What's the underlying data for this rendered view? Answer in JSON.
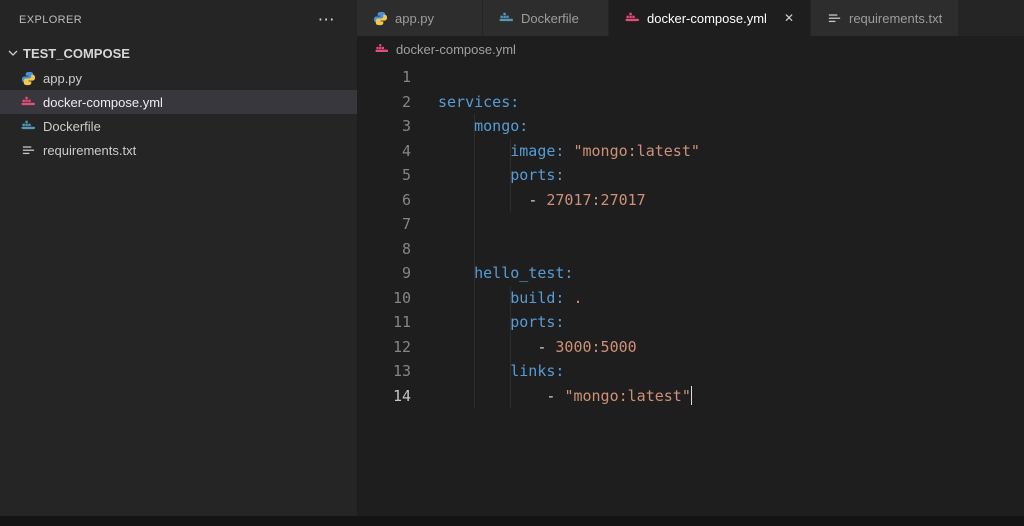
{
  "colors": {
    "python_blue": "#4a90d9",
    "python_yellow": "#f2c94c",
    "docker_blue": "#519aba",
    "compose_pink": "#e64d79",
    "text_gray": "#c5c5c5",
    "key_color": "#569cd6",
    "string_color": "#ce9178",
    "plain_color": "#d4d4d4"
  },
  "explorer": {
    "title": "EXPLORER",
    "more_actions": "⋯",
    "folder": {
      "label": "TEST_COMPOSE"
    },
    "files": [
      {
        "label": "app.py",
        "icon": "python-icon",
        "selected": false
      },
      {
        "label": "docker-compose.yml",
        "icon": "docker-compose-icon",
        "selected": true
      },
      {
        "label": "Dockerfile",
        "icon": "docker-icon",
        "selected": false
      },
      {
        "label": "requirements.txt",
        "icon": "text-file-icon",
        "selected": false
      }
    ]
  },
  "tabs": [
    {
      "label": "app.py",
      "icon": "python-icon",
      "active": false
    },
    {
      "label": "Dockerfile",
      "icon": "docker-icon",
      "active": false
    },
    {
      "label": "docker-compose.yml",
      "icon": "docker-compose-icon",
      "active": true,
      "close_label": "✕"
    },
    {
      "label": "requirements.txt",
      "icon": "text-file-icon",
      "active": false
    }
  ],
  "breadcrumb": {
    "label": "docker-compose.yml",
    "icon": "docker-compose-icon"
  },
  "editor": {
    "language": "yaml",
    "cursor_line": 14,
    "lines": [
      {
        "n": 1,
        "tokens": []
      },
      {
        "n": 2,
        "tokens": [
          [
            "services:",
            "key"
          ]
        ]
      },
      {
        "n": 3,
        "tokens": [
          [
            "    ",
            "pun"
          ],
          [
            "mongo:",
            "key"
          ]
        ]
      },
      {
        "n": 4,
        "tokens": [
          [
            "        ",
            "pun"
          ],
          [
            "image:",
            "key"
          ],
          [
            " ",
            "pun"
          ],
          [
            "\"mongo:latest\"",
            "str"
          ]
        ]
      },
      {
        "n": 5,
        "tokens": [
          [
            "        ",
            "pun"
          ],
          [
            "ports:",
            "key"
          ]
        ]
      },
      {
        "n": 6,
        "tokens": [
          [
            "          ",
            "pun"
          ],
          [
            "- ",
            "pun"
          ],
          [
            "27017:27017",
            "str"
          ]
        ]
      },
      {
        "n": 7,
        "tokens": []
      },
      {
        "n": 8,
        "tokens": []
      },
      {
        "n": 9,
        "tokens": [
          [
            "    ",
            "pun"
          ],
          [
            "hello_test:",
            "key"
          ]
        ]
      },
      {
        "n": 10,
        "tokens": [
          [
            "        ",
            "pun"
          ],
          [
            "build:",
            "key"
          ],
          [
            " ",
            "pun"
          ],
          [
            ".",
            "str"
          ]
        ]
      },
      {
        "n": 11,
        "tokens": [
          [
            "        ",
            "pun"
          ],
          [
            "ports:",
            "key"
          ]
        ]
      },
      {
        "n": 12,
        "tokens": [
          [
            "           ",
            "pun"
          ],
          [
            "- ",
            "pun"
          ],
          [
            "3000:5000",
            "str"
          ]
        ]
      },
      {
        "n": 13,
        "tokens": [
          [
            "        ",
            "pun"
          ],
          [
            "links:",
            "key"
          ]
        ]
      },
      {
        "n": 14,
        "tokens": [
          [
            "            ",
            "pun"
          ],
          [
            "- ",
            "pun"
          ],
          [
            "\"mongo:latest\"",
            "str"
          ]
        ]
      }
    ]
  }
}
